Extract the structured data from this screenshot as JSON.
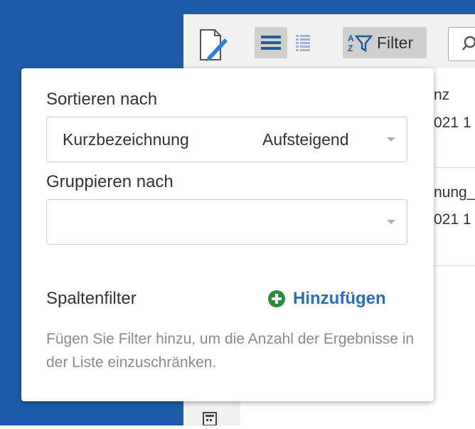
{
  "toolbar": {
    "filter_label": "Filter",
    "icons": [
      "edit-icon",
      "list-view-icon",
      "compact-list-icon",
      "filter-icon",
      "search-icon"
    ]
  },
  "list_rows": [
    {
      "line1": "nz",
      "line2": "021 1"
    },
    {
      "line1": "nung_",
      "line2": "021 1"
    }
  ],
  "popover": {
    "sort_label": "Sortieren nach",
    "sort_field": "Kurzbezeichnung",
    "sort_direction": "Aufsteigend",
    "group_label": "Gruppieren nach",
    "group_value": "",
    "column_filter_label": "Spaltenfilter",
    "add_label": "Hinzufügen",
    "hint": "Fügen Sie Filter hinzu, um die Anzahl der Ergebnisse in der Liste einzuschränken."
  },
  "colors": {
    "sidebar_blue": "#1c5ca8",
    "link_blue": "#2e6db4",
    "add_green": "#2e8b3e"
  }
}
